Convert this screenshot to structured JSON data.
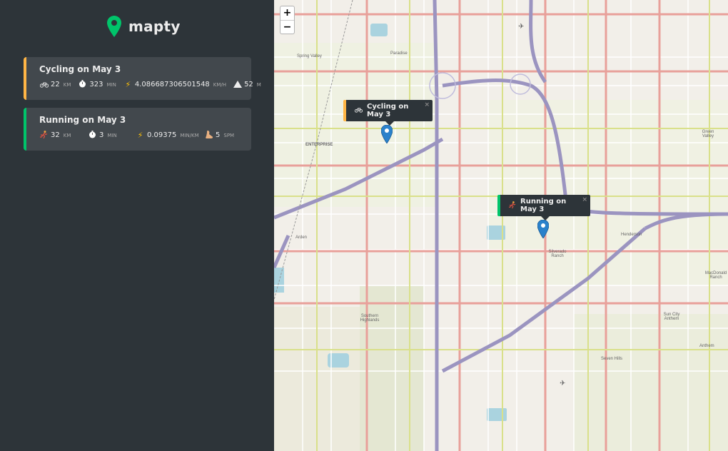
{
  "app": {
    "logo_text": "mapty",
    "accent_cycling": "#ffb545",
    "accent_running": "#00c46a"
  },
  "workouts": [
    {
      "type": "cycling",
      "title": "Cycling on May 3",
      "distance": "22",
      "distance_unit": "km",
      "duration": "323",
      "duration_unit": "min",
      "speed": "4.086687306501548",
      "speed_unit": "km/h",
      "elevation": "52",
      "elevation_unit": "m"
    },
    {
      "type": "running",
      "title": "Running on May 3",
      "distance": "32",
      "distance_unit": "km",
      "duration": "3",
      "duration_unit": "min",
      "pace": "0.09375",
      "pace_unit": "min/km",
      "cadence": "5",
      "cadence_unit": "spm"
    }
  ],
  "map": {
    "zoom_in": "+",
    "zoom_out": "−",
    "popups": [
      {
        "label": "Cycling on May 3",
        "icon": "bicycle-icon",
        "close": "×"
      },
      {
        "label": "Running on May 3",
        "icon": "runner-icon",
        "close": "×"
      }
    ],
    "labels": {
      "spring_valley": "Spring Valley",
      "paradise": "Paradise",
      "enterprise": "Enterprise",
      "henderson": "Henderson",
      "southern_highlands": "Southern Highlands",
      "silverado_ranch": "Silverado Ranch",
      "green_valley": "Green Valley",
      "arden": "Arden",
      "seven_hills": "Seven Hills",
      "anthem": "Anthem",
      "macdonald_ranch": "MacDonald Ranch",
      "sun_city_anthem": "Sun City Anthem"
    }
  }
}
